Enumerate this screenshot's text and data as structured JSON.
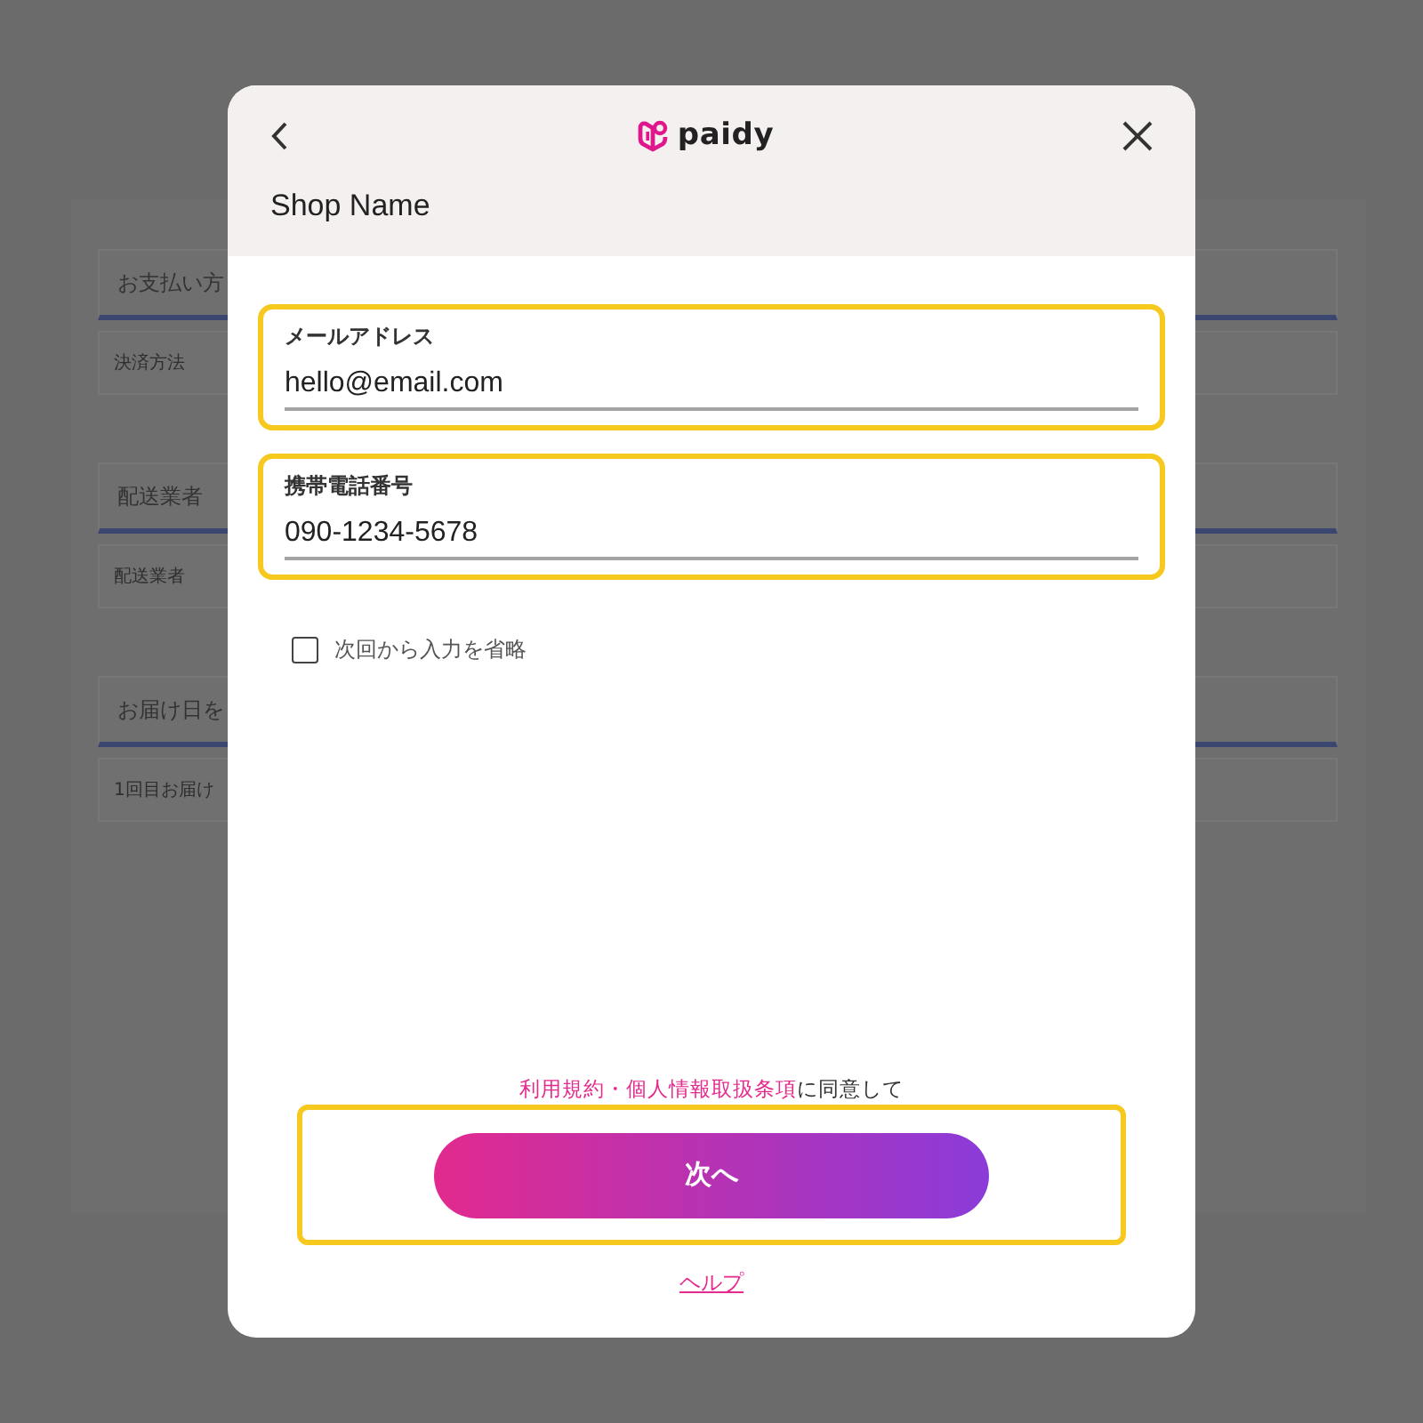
{
  "background_page": {
    "sections": [
      {
        "heading": "お支払い方",
        "row": "決済方法"
      },
      {
        "heading": "配送業者",
        "row": "配送業者"
      },
      {
        "heading": "お届け日を",
        "row": "1回目お届け"
      }
    ]
  },
  "dialog": {
    "logo": "paidy",
    "shop_name": "Shop Name",
    "fields": [
      {
        "label": "メールアドレス",
        "value": "hello@email.com",
        "highlighted": true
      },
      {
        "label": "携帯電話番号",
        "value": "090-1234-5678",
        "highlighted": true
      }
    ],
    "remember": {
      "label": "次回から入力を省略",
      "checked": false
    },
    "consent": {
      "link": "利用規約・個人情報取扱条項",
      "text": "に同意して"
    },
    "next_button": {
      "label": "次へ",
      "highlighted": true
    },
    "help_link": "ヘルプ"
  }
}
